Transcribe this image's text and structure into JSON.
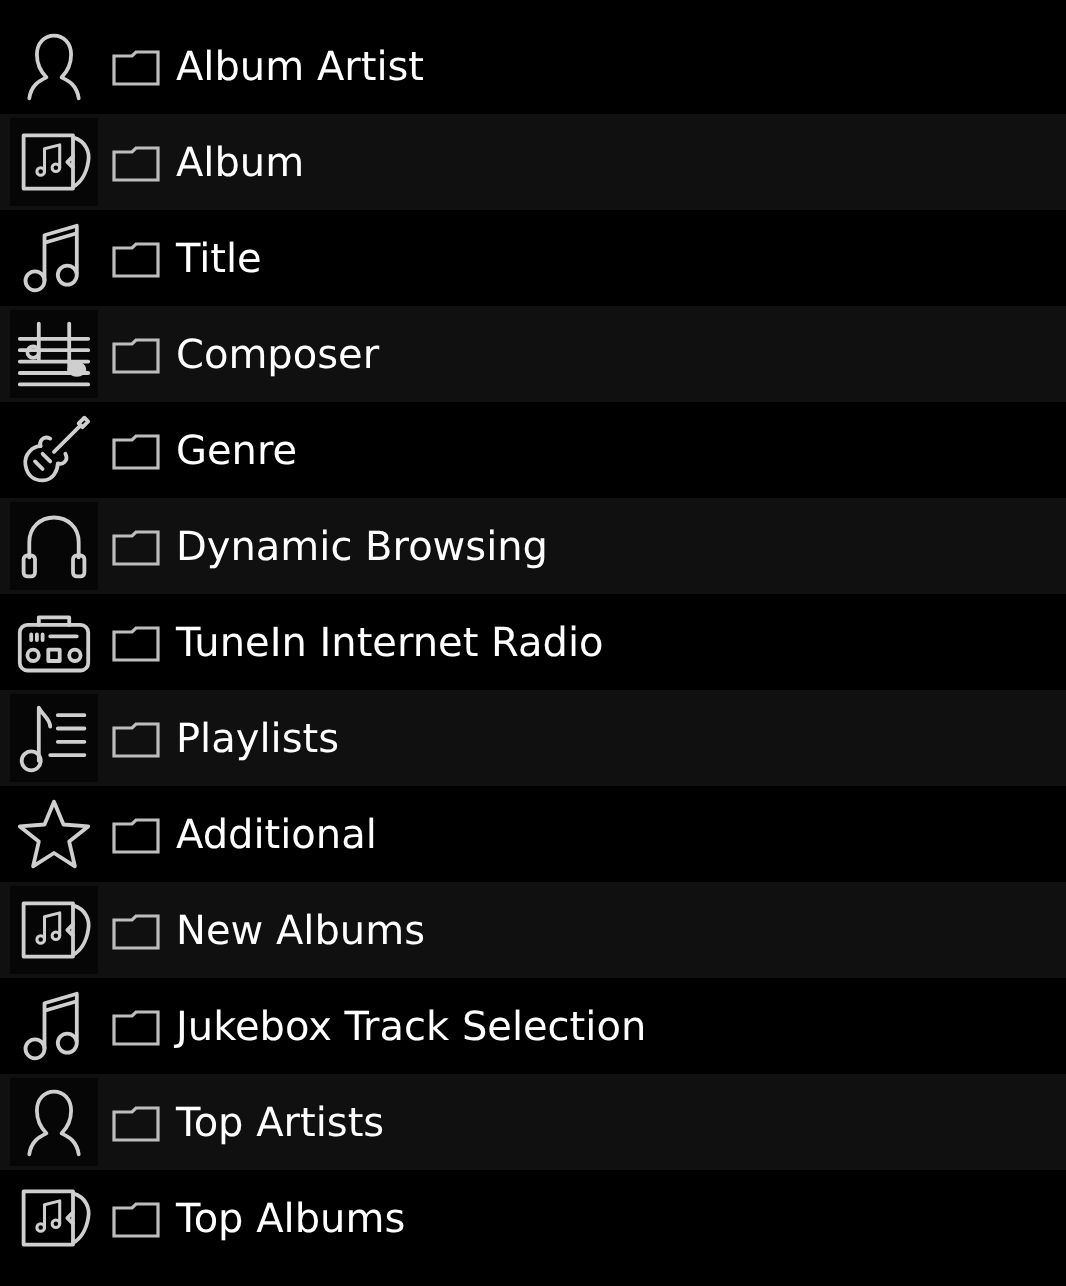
{
  "items": [
    {
      "label": "Album Artist",
      "kind": "person"
    },
    {
      "label": "Album",
      "kind": "album"
    },
    {
      "label": "Title",
      "kind": "note"
    },
    {
      "label": "Composer",
      "kind": "staff"
    },
    {
      "label": "Genre",
      "kind": "guitar"
    },
    {
      "label": "Dynamic Browsing",
      "kind": "headphones"
    },
    {
      "label": "TuneIn Internet Radio",
      "kind": "radio"
    },
    {
      "label": "Playlists",
      "kind": "playlist"
    },
    {
      "label": "Additional",
      "kind": "star"
    },
    {
      "label": "New Albums",
      "kind": "album"
    },
    {
      "label": "Jukebox Track Selection",
      "kind": "note"
    },
    {
      "label": "Top Artists",
      "kind": "person"
    },
    {
      "label": "Top Albums",
      "kind": "album"
    }
  ]
}
